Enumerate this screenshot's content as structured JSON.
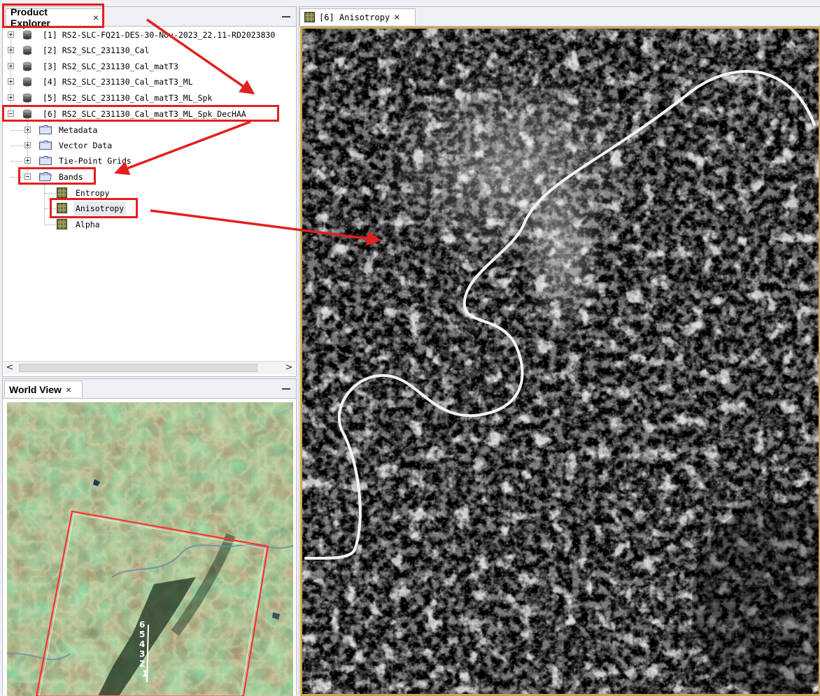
{
  "product_explorer": {
    "title": "Product Explorer",
    "close_glyph": "×",
    "products": [
      {
        "index": "[1]",
        "name": "RS2-SLC-FQ21-DES-30-Nov-2023_22.11-RD2023830"
      },
      {
        "index": "[2]",
        "name": "RS2_SLC_231130_Cal"
      },
      {
        "index": "[3]",
        "name": "RS2_SLC_231130_Cal_matT3"
      },
      {
        "index": "[4]",
        "name": "RS2_SLC_231130_Cal_matT3_ML"
      },
      {
        "index": "[5]",
        "name": "RS2_SLC_231130_Cal_matT3_ML_Spk"
      },
      {
        "index": "[6]",
        "name": "RS2_SLC_231130_Cal_matT3_ML_Spk_DecHAA"
      }
    ],
    "groups": [
      "Metadata",
      "Vector Data",
      "Tie-Point Grids",
      "Bands"
    ],
    "bands": [
      "Entropy",
      "Anisotropy",
      "Alpha"
    ],
    "scroll_left": "<",
    "scroll_right": ">"
  },
  "world_view": {
    "title": "World View",
    "close_glyph": "×",
    "footprint_labels": [
      "6",
      "5",
      "4",
      "3",
      "2",
      "1"
    ]
  },
  "image_view": {
    "tab_label": "[6] Anisotropy",
    "close_glyph": "×"
  },
  "colors": {
    "annotation_red": "#e2201f",
    "panel_border": "#b9bcc1",
    "image_frame": "#c9a84a"
  },
  "icons": {
    "product": "database-icon",
    "group": "folder-icon",
    "band": "raster-band-icon",
    "minimize": "minimize-icon"
  }
}
